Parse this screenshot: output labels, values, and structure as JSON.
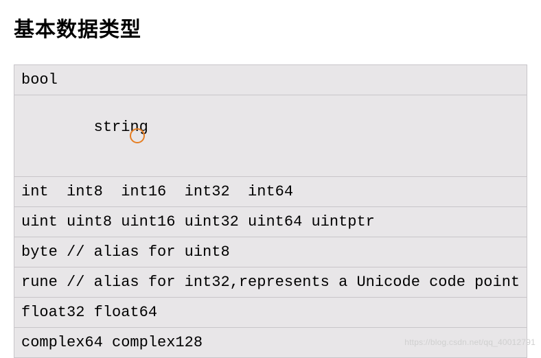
{
  "heading": "基本数据类型",
  "rows": [
    "bool",
    "string",
    "int  int8  int16  int32  int64",
    "uint uint8 uint16 uint32 uint64 uintptr",
    "byte // alias for uint8",
    "rune // alias for int32,represents a Unicode code point",
    "float32 float64",
    "complex64 complex128"
  ],
  "watermark": "https://blog.csdn.net/qq_40012791"
}
